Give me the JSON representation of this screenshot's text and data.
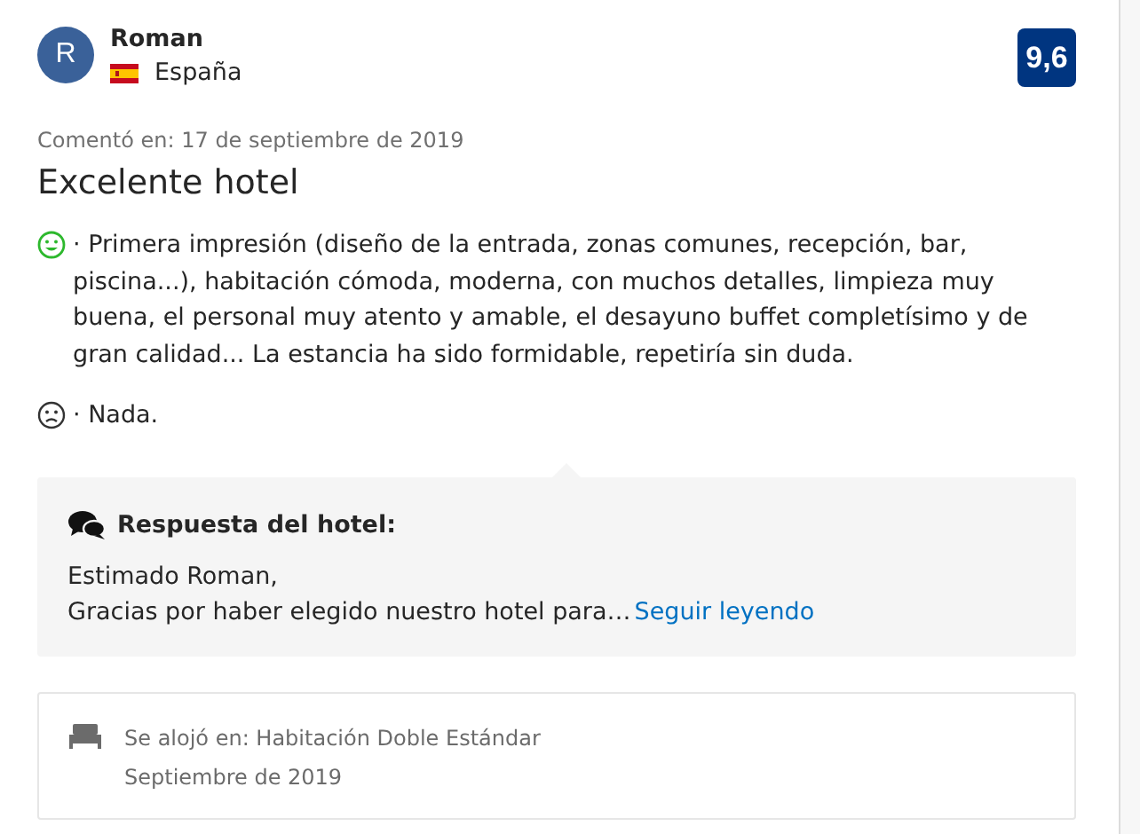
{
  "reviewer": {
    "initial": "R",
    "name": "Roman",
    "country": "España"
  },
  "score": "9,6",
  "review_date": "Comentó en: 17 de septiembre de 2019",
  "title": "Excelente hotel",
  "comments": [
    {
      "kind": "positive",
      "text": "· Primera impresión (diseño de la entrada, zonas comunes, recepción, bar, piscina...), habitación cómoda, moderna, con muchos detalles, limpieza muy buena, el personal muy atento y amable, el desayuno buffet completísimo y de gran calidad... La estancia ha sido formidable, repetiría sin duda."
    },
    {
      "kind": "negative",
      "text": "· Nada."
    }
  ],
  "hotel_response": {
    "heading": "Respuesta del hotel:",
    "lines": [
      "Estimado Roman,",
      "Gracias por haber elegido nuestro hotel para…"
    ],
    "link": "Seguir leyendo"
  },
  "stay": {
    "room": "Se alojó en: Habitación Doble Estándar",
    "date": "Septiembre de 2019"
  }
}
